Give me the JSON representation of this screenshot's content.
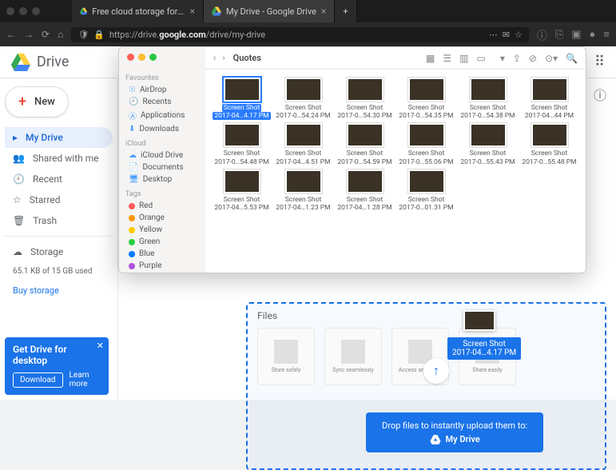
{
  "browser": {
    "tabs": [
      {
        "title": "Free cloud storage for person…",
        "active": false
      },
      {
        "title": "My Drive - Google Drive",
        "active": true
      }
    ],
    "url": "https://drive.google.com/drive/my-drive",
    "url_display_prefix": "https://drive.",
    "url_display_bold": "google.com",
    "url_display_suffix": "/drive/my-drive"
  },
  "drive": {
    "product": "Drive",
    "new_label": "New",
    "sidebar": [
      {
        "icon": "▸",
        "label": "My Drive",
        "active": true
      },
      {
        "icon": "👥",
        "label": "Shared with me"
      },
      {
        "icon": "🕘",
        "label": "Recent"
      },
      {
        "icon": "☆",
        "label": "Starred"
      },
      {
        "icon": "🗑",
        "label": "Trash"
      }
    ],
    "storage_label": "Storage",
    "storage_used": "65.1 KB of 15 GB used",
    "buy_storage": "Buy storage",
    "files_label": "Files",
    "tiles": [
      {
        "caption": "Store safely"
      },
      {
        "caption": "Sync seamlessly"
      },
      {
        "caption": "Access anywhere"
      },
      {
        "caption": "Share easily"
      }
    ],
    "drop_text": "Drop files to instantly upload them to:",
    "drop_target": "My Drive",
    "dragged_file": {
      "name": "Screen Shot",
      "time": "2017-04…4.17 PM"
    }
  },
  "promo": {
    "title": "Get Drive for desktop",
    "download": "Download",
    "learn": "Learn more"
  },
  "finder": {
    "title": "Quotes",
    "favourites_label": "Favourites",
    "favourites": [
      "AirDrop",
      "Recents",
      "Applications",
      "Downloads"
    ],
    "icloud_label": "iCloud",
    "icloud": [
      "iCloud Drive",
      "Documents",
      "Desktop"
    ],
    "tags_label": "Tags",
    "tags": [
      {
        "label": "Red",
        "color": "#ff5b59"
      },
      {
        "label": "Orange",
        "color": "#ff9500"
      },
      {
        "label": "Yellow",
        "color": "#ffcc00"
      },
      {
        "label": "Green",
        "color": "#28cd41"
      },
      {
        "label": "Blue",
        "color": "#007aff"
      },
      {
        "label": "Purple",
        "color": "#af52de"
      }
    ],
    "files": [
      {
        "name": "Screen Shot",
        "time": "2017-04…4.17 PM",
        "selected": true
      },
      {
        "name": "Screen Shot",
        "time": "2017-0…54.24 PM"
      },
      {
        "name": "Screen Shot",
        "time": "2017-0…54.30 PM"
      },
      {
        "name": "Screen Shot",
        "time": "2017-0…54.35 PM"
      },
      {
        "name": "Screen Shot",
        "time": "2017-0…54.38 PM"
      },
      {
        "name": "Screen Shot",
        "time": "2017-04…44 PM"
      },
      {
        "name": "Screen Shot",
        "time": "2017-0…54.48 PM"
      },
      {
        "name": "Screen Shot",
        "time": "2017-04…4.51 PM"
      },
      {
        "name": "Screen Shot",
        "time": "2017-0…54.59 PM"
      },
      {
        "name": "Screen Shot",
        "time": "2017-0…55.06 PM"
      },
      {
        "name": "Screen Shot",
        "time": "2017-0…55.43 PM"
      },
      {
        "name": "Screen Shot",
        "time": "2017-0…55.48 PM"
      },
      {
        "name": "Screen Shot",
        "time": "2017-04…5.53 PM"
      },
      {
        "name": "Screen Shot",
        "time": "2017-04…1.23 PM"
      },
      {
        "name": "Screen Shot",
        "time": "2017-04…1.28 PM"
      },
      {
        "name": "Screen Shot",
        "time": "2017-0…01.31 PM"
      }
    ]
  }
}
